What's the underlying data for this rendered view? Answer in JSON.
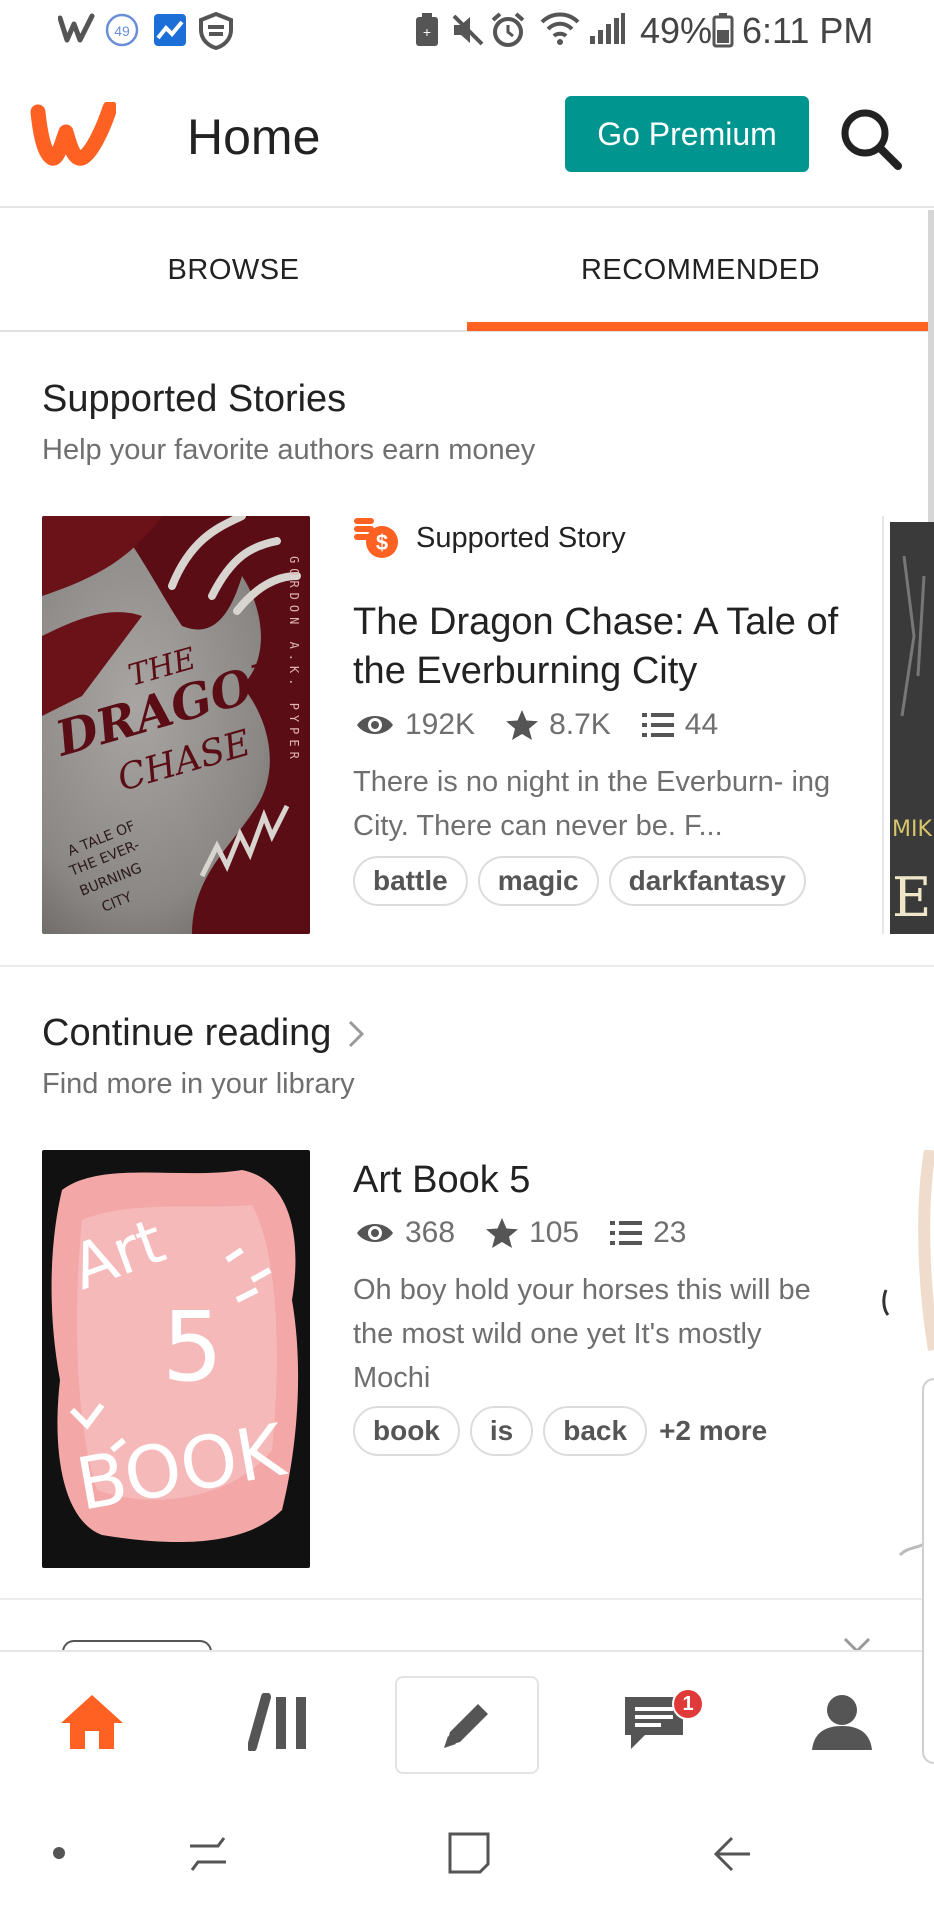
{
  "status_bar": {
    "battery_percent": "49%",
    "time": "6:11 PM",
    "notification_count": "49"
  },
  "app_bar": {
    "title": "Home",
    "premium_label": "Go Premium"
  },
  "tabs": [
    {
      "label": "BROWSE",
      "active": false
    },
    {
      "label": "RECOMMENDED",
      "active": true
    }
  ],
  "supported_section": {
    "title": "Supported Stories",
    "subtitle": "Help your favorite authors earn money",
    "story": {
      "badge_label": "Supported Story",
      "title": "The Dragon Chase: A Tale of the Everburning City",
      "reads": "192K",
      "votes": "8.7K",
      "parts": "44",
      "description": "There is no night in the Everburn- ing City.   There can never be.   F...",
      "tags": [
        "battle",
        "magic",
        "darkfantasy"
      ],
      "cover": {
        "line1": "THE",
        "line2": "DRAGON",
        "line3": "CHASE",
        "sub1": "A TALE OF",
        "sub2": "THE EVER-",
        "sub3": "BURNING",
        "sub4": "CITY",
        "author": "GORDON A.K. PYPER"
      }
    },
    "next_cover_partial": {
      "text1": "MIK",
      "text2": "EL"
    }
  },
  "continue_section": {
    "title": "Continue reading",
    "subtitle": "Find more in your library",
    "story": {
      "title": "Art Book 5",
      "reads": "368",
      "votes": "105",
      "parts": "23",
      "description": "Oh boy hold your horses this will be the most wild one yet       It's mostly Mochi",
      "tags": [
        "book",
        "is",
        "back"
      ],
      "more_tags": "+2 more",
      "cover": {
        "line1": "Art",
        "line2": "5",
        "line3": "BOOK"
      }
    }
  },
  "bottom_nav": {
    "message_badge": "1"
  },
  "colors": {
    "brand_orange": "#ff6122",
    "premium_teal": "#00968f",
    "badge_red": "#e0393a"
  }
}
